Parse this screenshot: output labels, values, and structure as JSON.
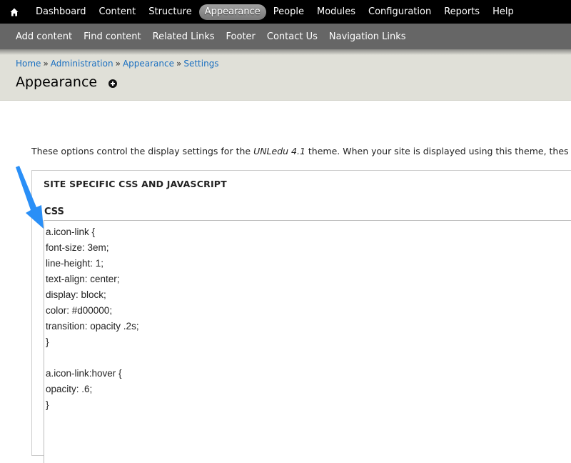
{
  "toolbar": {
    "home_icon": "home-icon",
    "items": [
      {
        "label": "Dashboard",
        "active": false
      },
      {
        "label": "Content",
        "active": false
      },
      {
        "label": "Structure",
        "active": false
      },
      {
        "label": "Appearance",
        "active": true
      },
      {
        "label": "People",
        "active": false
      },
      {
        "label": "Modules",
        "active": false
      },
      {
        "label": "Configuration",
        "active": false
      },
      {
        "label": "Reports",
        "active": false
      },
      {
        "label": "Help",
        "active": false
      }
    ]
  },
  "shortcuts": {
    "items": [
      {
        "label": "Add content"
      },
      {
        "label": "Find content"
      },
      {
        "label": "Related Links"
      },
      {
        "label": "Footer"
      },
      {
        "label": "Contact Us"
      },
      {
        "label": "Navigation Links"
      }
    ]
  },
  "breadcrumb": {
    "items": [
      "Home",
      "Administration",
      "Appearance",
      "Settings"
    ],
    "separator": "»"
  },
  "page": {
    "title": "Appearance",
    "add_shortcut_icon": "plus-circle-icon"
  },
  "intro": {
    "before": "These options control the display settings for the ",
    "theme_name": "UNLedu 4.1",
    "after": " theme. When your site is displayed using this theme, thes"
  },
  "fieldset": {
    "legend": "SITE SPECIFIC CSS AND JAVASCRIPT",
    "css_label": "CSS",
    "css_lines": [
      "a.icon-link {",
      "font-size: 3em;",
      "line-height: 1;",
      "text-align: center;",
      "display: block;",
      "color: #d00000;",
      "transition: opacity .2s;",
      "}",
      "",
      "a.icon-link:hover {",
      "opacity: .6;",
      "}"
    ]
  },
  "annotation": {
    "arrow_color": "#2a8ff7",
    "arrow_icon": "arrow-annotation-icon"
  },
  "colors": {
    "toolbar_bg": "#000000",
    "shortcuts_bg": "#666666",
    "header_bg": "#e0e0d8",
    "link": "#1a6fc0"
  }
}
